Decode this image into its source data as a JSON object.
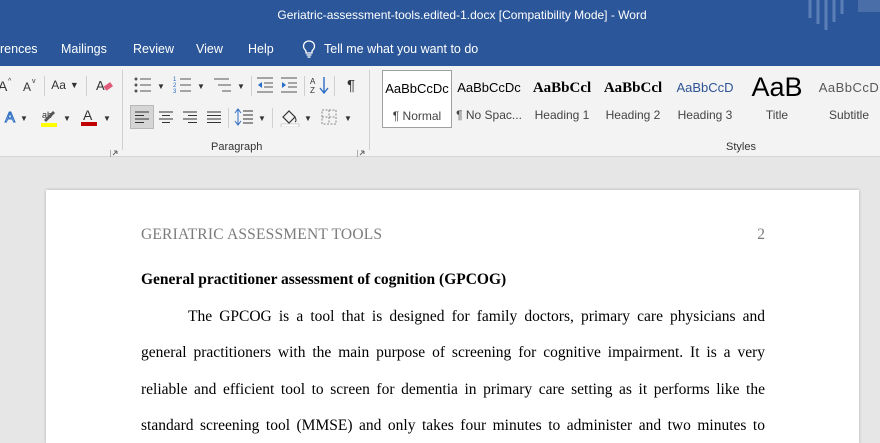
{
  "window": {
    "title": "Geriatric-assessment-tools.edited-1.docx [Compatibility Mode]  -  Word"
  },
  "ribbon_tabs": [
    {
      "label": "rences"
    },
    {
      "label": "Mailings"
    },
    {
      "label": "Review"
    },
    {
      "label": "View"
    },
    {
      "label": "Help"
    }
  ],
  "tell_me": {
    "label": "Tell me what you want to do"
  },
  "font_group": {
    "change_case_label": "Aa"
  },
  "paragraph_group": {
    "label": "Paragraph"
  },
  "styles_group": {
    "label": "Styles",
    "items": [
      {
        "sample": "AaBbCcDc",
        "label": "¶ Normal",
        "selected": true
      },
      {
        "sample": "AaBbCcDc",
        "label": "¶ No Spac..."
      },
      {
        "sample": "AaBbCcl",
        "label": "Heading 1"
      },
      {
        "sample": "AaBbCcl",
        "label": "Heading 2"
      },
      {
        "sample": "AaBbCcD",
        "label": "Heading 3"
      },
      {
        "sample": "AaB",
        "label": "Title"
      },
      {
        "sample": "AaBbCcD",
        "label": "Subtitle"
      }
    ]
  },
  "document": {
    "running_header": "GERIATRIC ASSESSMENT TOOLS",
    "page_number": "2",
    "heading": "General practitioner assessment of cognition (GPCOG)",
    "lines": [
      "The GPCOG is a tool that is designed for family doctors, primary care physicians and",
      "general practitioners with the main purpose of screening for cognitive impairment. It is a very",
      "reliable and efficient tool to screen for dementia in primary care setting as it performs like the",
      "standard screening tool (MMSE) and only takes four minutes to administer and two minutes to"
    ]
  },
  "colors": {
    "titlebar": "#2b579a",
    "ribbon": "#f3f3f3",
    "workspace": "#e6e6e6",
    "font_color_red": "#c00000",
    "highlight_yellow": "#ffff00"
  }
}
